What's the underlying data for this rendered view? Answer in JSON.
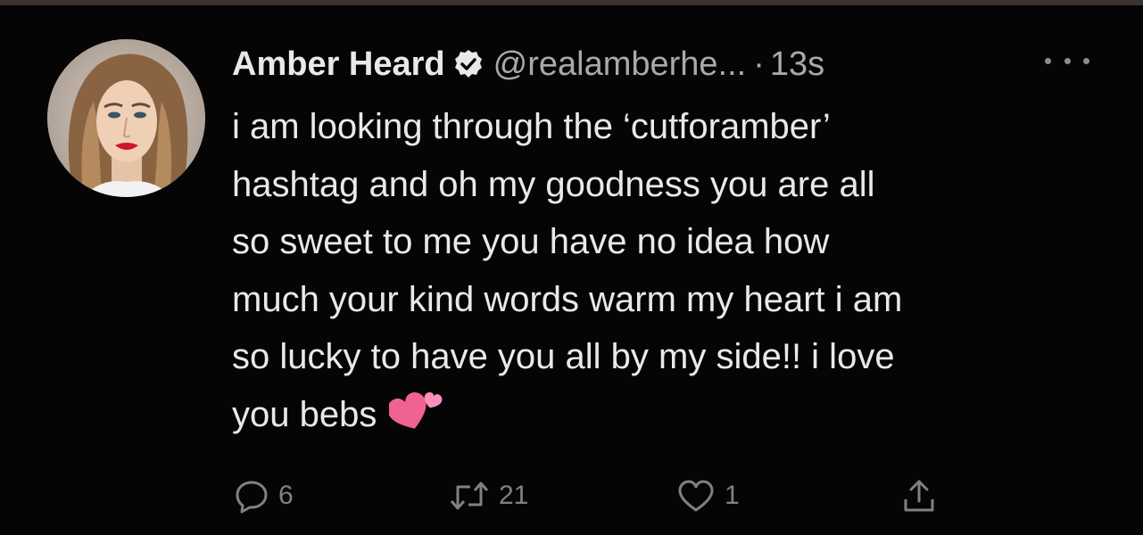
{
  "tweet": {
    "author_name": "Amber Heard",
    "handle": "@realamberhe...",
    "separator": "·",
    "time": "13s",
    "verified_icon": "verified-badge-icon",
    "more_icon": "more-options-icon",
    "text_lines": [
      "i am looking through the ‘cutforamber’",
      "hashtag and oh my goodness you are all",
      "so sweet to me you have no idea how",
      "much your kind words warm my heart i am",
      "so lucky to have you all by my side!! i love",
      "you bebs"
    ],
    "emoji": "two-hearts-emoji"
  },
  "actions": {
    "reply": {
      "icon": "reply-icon",
      "count": "6"
    },
    "retweet": {
      "icon": "retweet-icon",
      "count": "21"
    },
    "like": {
      "icon": "heart-icon",
      "count": "1"
    },
    "share": {
      "icon": "share-icon"
    }
  },
  "colors": {
    "background": "#000000",
    "text": "#e7e9ea",
    "secondary_text": "#a7a9ab",
    "icon_gray": "#7f8184",
    "emoji_pink": "#f06292"
  }
}
